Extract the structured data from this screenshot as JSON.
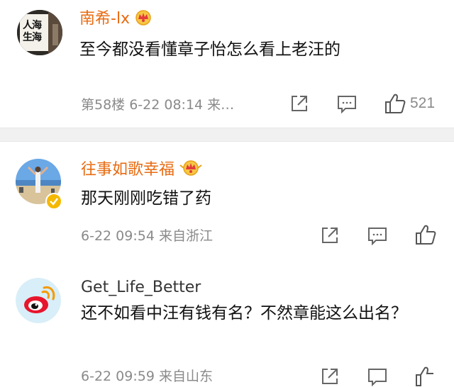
{
  "comments": [
    {
      "username": "南希-lx",
      "text": "至今都没看懂章子怡怎么看上老汪的",
      "meta": "第58楼 6-22 08:14 来…",
      "likes": "521",
      "avatar_text": "人海生海"
    },
    {
      "username": "往事如歌幸福",
      "text": "那天刚刚吃错了药",
      "meta": "6-22 09:54 来自浙江"
    },
    {
      "username": "Get_Life_Better",
      "text": "还不如看中汪有钱有名？不然章能这么出名？",
      "meta": "6-22 09:59 来自山东"
    }
  ],
  "icons": {
    "share": "share-icon",
    "comment": "comment-icon",
    "like": "thumbs-up-icon",
    "vip": "crown-icon"
  },
  "colors": {
    "vip_name": "#e86b12",
    "normal_name": "#333333",
    "meta": "#8a8a8a",
    "weibo_red": "#e6162d"
  }
}
